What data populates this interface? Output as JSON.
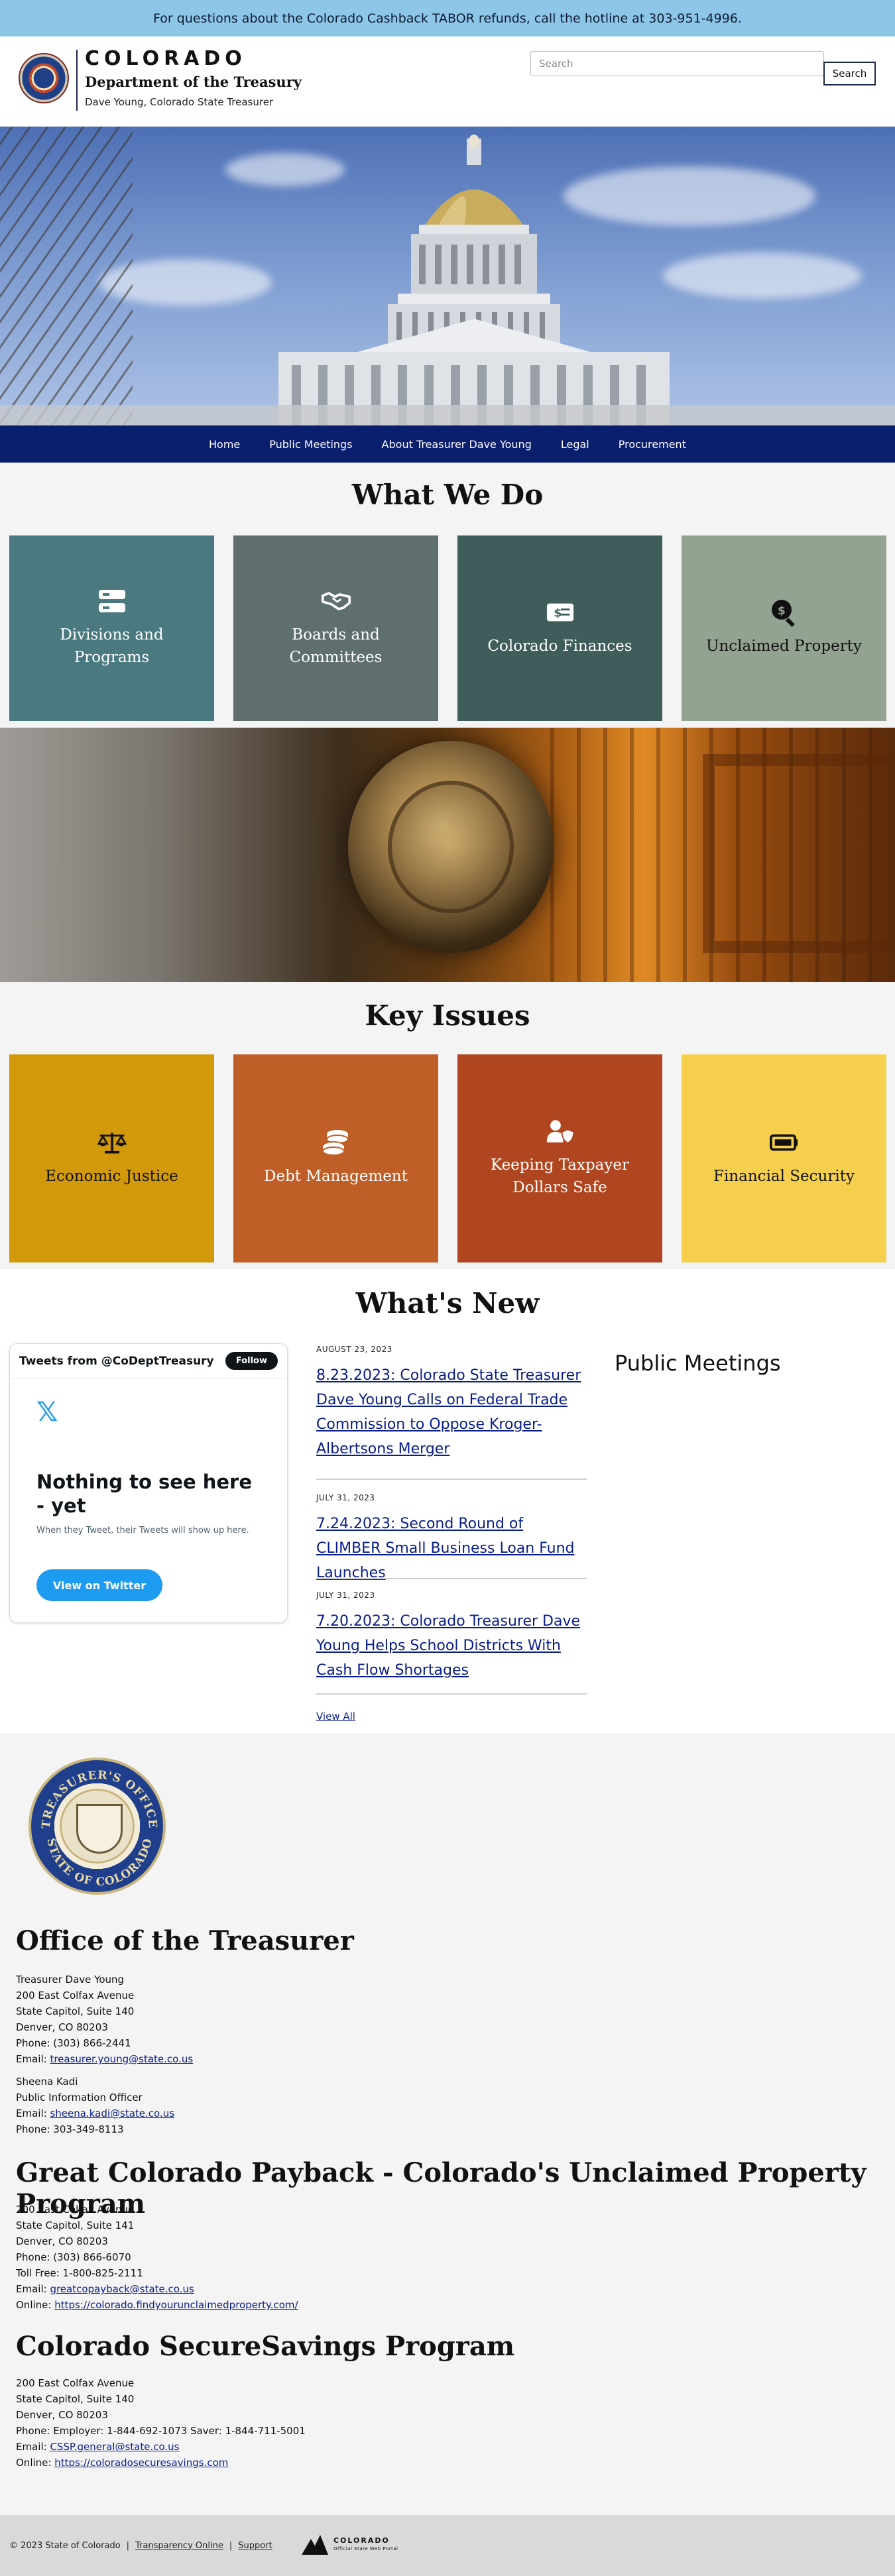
{
  "alert": {
    "text": "For questions about the Colorado Cashback TABOR refunds, call the hotline at 303-951-4996."
  },
  "header": {
    "state": "COLORADO",
    "department": "Department of the Treasury",
    "subtitle": "Dave Young, Colorado State Treasurer",
    "search_placeholder": "Search",
    "search_button": "Search"
  },
  "nav": {
    "items": [
      {
        "label": "Home"
      },
      {
        "label": "Public Meetings"
      },
      {
        "label": "About Treasurer Dave Young"
      },
      {
        "label": "Legal"
      },
      {
        "label": "Procurement"
      }
    ]
  },
  "what_we_do": {
    "title": "What We Do",
    "tiles": [
      {
        "label": "Divisions and Programs",
        "icon": "list-icon",
        "color": "#4a7a80"
      },
      {
        "label": "Boards and Committees",
        "icon": "handshake-icon",
        "color": "#5f6f70"
      },
      {
        "label": "Colorado Finances",
        "icon": "money-bill-icon",
        "color": "#3f5e5b"
      },
      {
        "label": "Unclaimed Property",
        "icon": "search-dollar-icon",
        "color": "#93a392"
      }
    ]
  },
  "key_issues": {
    "title": "Key Issues",
    "tiles": [
      {
        "label": "Economic Justice",
        "icon": "scale-icon",
        "color": "#d29a0a"
      },
      {
        "label": "Debt Management",
        "icon": "coins-icon",
        "color": "#bf5e26"
      },
      {
        "label": "Keeping Taxpayer Dollars Safe",
        "icon": "user-shield-icon",
        "color": "#b0461f"
      },
      {
        "label": "Financial Security",
        "icon": "battery-icon",
        "color": "#f6d04d"
      }
    ]
  },
  "whats_new": {
    "title": "What's New",
    "twitter": {
      "header": "Tweets from @CoDeptTreasury",
      "follow": "Follow",
      "empty_title": "Nothing to see here - yet",
      "empty_sub": "When they Tweet, their Tweets will show up here.",
      "view_button": "View on Twitter"
    },
    "news": [
      {
        "date": "AUGUST 23, 2023",
        "title": "8.23.2023: Colorado State Treasurer Dave Young Calls on Federal Trade Commission to Oppose Kroger-Albertsons Merger"
      },
      {
        "date": "JULY 31, 2023",
        "title": "7.24.2023: Second Round of CLIMBER Small Business Loan Fund Launches"
      },
      {
        "date": "JULY 31, 2023",
        "title": "7.20.2023: Colorado Treasurer Dave Young Helps School Districts With Cash Flow Shortages"
      }
    ],
    "view_all": "View All",
    "public_meetings_title": "Public Meetings"
  },
  "footer": {
    "seal_text_top": "TREASURER'S OFFICE",
    "seal_text_bottom": "STATE OF COLORADO",
    "office": {
      "title": "Office of the Treasurer",
      "lines": [
        "Treasurer Dave Young",
        "200 East Colfax Avenue",
        "State Capitol, Suite 140",
        "Denver, CO 80203",
        "Phone: (303) 866-2441"
      ],
      "email_label": "Email: ",
      "email": "treasurer.young@state.co.us",
      "pio_lines": [
        "Sheena Kadi",
        "Public Information Officer"
      ],
      "pio_email_label": "Email: ",
      "pio_email": "sheena.kadi@state.co.us",
      "pio_phone": "Phone: 303-349-8113"
    },
    "payback": {
      "title": "Great Colorado Payback - Colorado's Unclaimed Property Program",
      "lines": [
        "200 East Colfax Avenue",
        "State Capitol, Suite 141",
        "Denver, CO 80203",
        "Phone: (303) 866-6070",
        "Toll Free:  1-800-825-2111"
      ],
      "email_label": "Email: ",
      "email": "greatcopayback@state.co.us",
      "online_label": "Online: ",
      "online": "https://colorado.findyourunclaimedproperty.com/"
    },
    "securesavings": {
      "title": "Colorado SecureSavings Program",
      "lines": [
        "200 East Colfax Avenue",
        "State Capitol, Suite 140",
        "Denver, CO 80203",
        "Phone: Employer: 1-844-692-1073  Saver: 1-844-711-5001"
      ],
      "email_label": "Email: ",
      "email": "CSSP.general@state.co.us",
      "online_label": "Online: ",
      "online": "https://coloradosecuresavings.com"
    }
  },
  "bottom_bar": {
    "copyright": "© 2023 State of Colorado",
    "link1": "Transparency Online",
    "link2": "Support",
    "logo_text": "COLORADO",
    "logo_sub": "Official State Web Portal"
  }
}
